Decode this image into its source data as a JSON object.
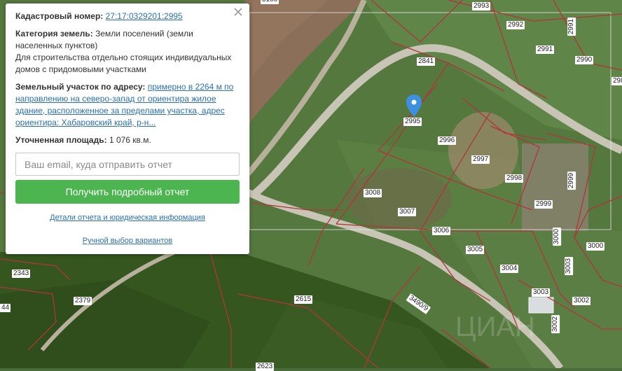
{
  "card": {
    "cadastral_label": "Кадастровый номер:",
    "cadastral_value": "27:17:0329201:2995",
    "category_label": "Категория земель:",
    "category_value": "Земли поселений (земли населенных пунктов)",
    "usage_text": "Для строительства отдельно стоящих индивидуальных домов с придомовыми участками",
    "address_label": "Земельный участок по адресу:",
    "address_value": "примерно в 2264 м по направлению на северо-запад от ориентира жилое здание, расположенное за пределами участка, адрес ориентира: Хабаровский край, р-н...",
    "area_label": "Уточненная площадь:",
    "area_value": "1 076 кв.м.",
    "email_placeholder": "Ваш email, куда отправить отчет",
    "submit_label": "Получить подробный отчет",
    "details_link": "Детали отчета и юридическая информация",
    "manual_link": "Ручной выбор вариантов",
    "close_icon": "close-icon"
  },
  "map": {
    "marker_icon": "map-pin-icon",
    "accent_color": "#4cb550",
    "link_color": "#2a6fb0",
    "parcel_line_color": "#b2343c",
    "pin_color": "#3d8fe0",
    "top_partial_label": "5100",
    "right_partial_label": "298",
    "left_partial_label": "44",
    "bottom_partial_label": "2623",
    "watermark": "ЦИАН"
  },
  "parcels": [
    "2993",
    "2992",
    "2991",
    "2991",
    "2990",
    "2841",
    "2995",
    "2996",
    "2997",
    "2998",
    "2999",
    "2999",
    "3008",
    "3007",
    "3006",
    "3005",
    "3004",
    "3003",
    "3003",
    "3002",
    "3002",
    "3000",
    "3000",
    "2343",
    "2379",
    "2615",
    "3490/9"
  ]
}
